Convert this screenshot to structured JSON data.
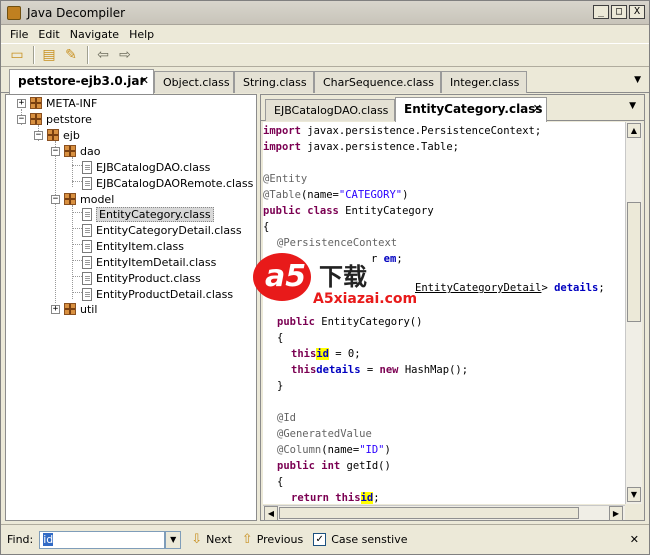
{
  "window": {
    "title": "Java Decompiler",
    "controls": {
      "minimize": "_",
      "maximize": "□",
      "close": "X"
    }
  },
  "menu": [
    "File",
    "Edit",
    "Navigate",
    "Help"
  ],
  "toolbar": {
    "icons": [
      "open-folder-icon",
      "open-type-icon",
      "search-icon",
      "back-arrow-icon",
      "forward-arrow-icon"
    ]
  },
  "top_tabs": [
    {
      "label": "petstore-ejb3.0.jar",
      "active": true
    },
    {
      "label": "Object.class"
    },
    {
      "label": "String.class"
    },
    {
      "label": "CharSequence.class"
    },
    {
      "label": "Integer.class"
    }
  ],
  "tree": {
    "meta": "META-INF",
    "petstore": "petstore",
    "ejb": "ejb",
    "dao": "dao",
    "dao_files": [
      "EJBCatalogDAO.class",
      "EJBCatalogDAORemote.class"
    ],
    "model": "model",
    "model_files": [
      "EntityCategory.class",
      "EntityCategoryDetail.class",
      "EntityItem.class",
      "EntityItemDetail.class",
      "EntityProduct.class",
      "EntityProductDetail.class"
    ],
    "util": "util",
    "selected": "EntityCategory.class"
  },
  "editor_tabs": [
    {
      "label": "EJBCatalogDAO.class"
    },
    {
      "label": "EntityCategory.class",
      "active": true
    }
  ],
  "code": {
    "l1a": "import",
    "l1b": " javax.persistence.PersistenceContext;",
    "l2a": "import",
    "l2b": " javax.persistence.Table;",
    "l3": "@Entity",
    "l4a": "@Table",
    "l4b": "(name=",
    "l4c": "\"CATEGORY\"",
    "l4d": ")",
    "l5a": "public class",
    "l5b": " EntityCategory",
    "l6": "{",
    "l7": "@PersistenceContext",
    "l8a": "r ",
    "l8b": "em",
    ";": ";",
    "l9a": "EntityCategoryDetail",
    "l9b": "> ",
    "l9c": "details",
    "l10a": "public",
    "l10b": " EntityCategory()",
    "l11": "{",
    "l12a": "this",
    ".": ".",
    "l12b": "id",
    "l12c": " = 0;",
    "l13a": "this",
    "l13b": "details",
    "l13c": " = ",
    "l13d": "new",
    "l13e": " HashMap();",
    "l14": "}",
    "l15": "@Id",
    "l16": "@GeneratedValue",
    "l17a": "@Column",
    "l17b": "(name=",
    "l17c": "\"ID\"",
    "l17d": ")",
    "l18a": "public int",
    "l18b": " getId()",
    "l19": "{",
    "l20a": "return this",
    "l20b": "id"
  },
  "watermark": {
    "logo": "a5",
    "cn": "下载",
    "domain": "A5xiazai.com"
  },
  "find": {
    "label": "Find:",
    "value": "id",
    "next": "Next",
    "previous": "Previous",
    "case_sensitive": "Case senstive",
    "case_checked": true,
    "close": "✕"
  }
}
